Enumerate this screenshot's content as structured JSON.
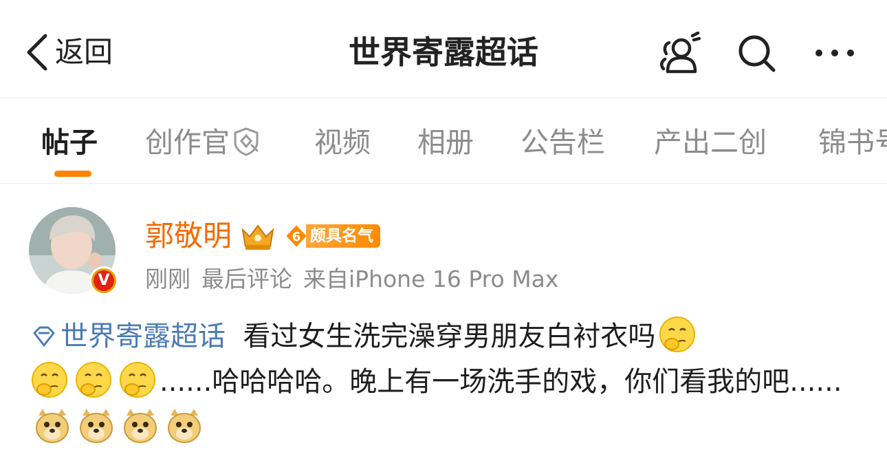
{
  "header": {
    "back_label": "返回",
    "title": "世界寄露超话",
    "icons": [
      "users-icon",
      "search-icon",
      "more-icon"
    ]
  },
  "tabs": [
    {
      "label": "帖子",
      "active": true
    },
    {
      "label": "创作官",
      "active": false,
      "badge_icon": "creator-badge-icon"
    },
    {
      "label": "视频",
      "active": false
    },
    {
      "label": "相册",
      "active": false
    },
    {
      "label": "公告栏",
      "active": false
    },
    {
      "label": "产出二创",
      "active": false
    },
    {
      "label": "锦书号",
      "active": false
    }
  ],
  "post": {
    "author": {
      "name": "郭敬明",
      "level_number": "6",
      "level_text": "颇具名气",
      "verified_icon": "v-verified-icon"
    },
    "meta": {
      "time": "刚刚",
      "action": "最后评论",
      "source": "来自iPhone 16 Pro Max"
    },
    "topic": "世界寄露超话",
    "text_1": "看过女生洗完澡穿男朋友白衬衣吗",
    "text_2": "......哈哈哈哈。晚上有一场洗手的戏，你们看我的吧......",
    "emojis_1": [
      "thinking-emoji",
      "thinking-emoji",
      "thinking-emoji",
      "thinking-emoji"
    ],
    "emojis_2": [
      "doge-emoji",
      "doge-emoji",
      "doge-emoji",
      "doge-emoji"
    ]
  },
  "colors": {
    "accent_orange": "#ff8200",
    "username_orange": "#f26c00",
    "topic_blue": "#4a7bb4",
    "muted_gray": "#8c8c8c"
  }
}
